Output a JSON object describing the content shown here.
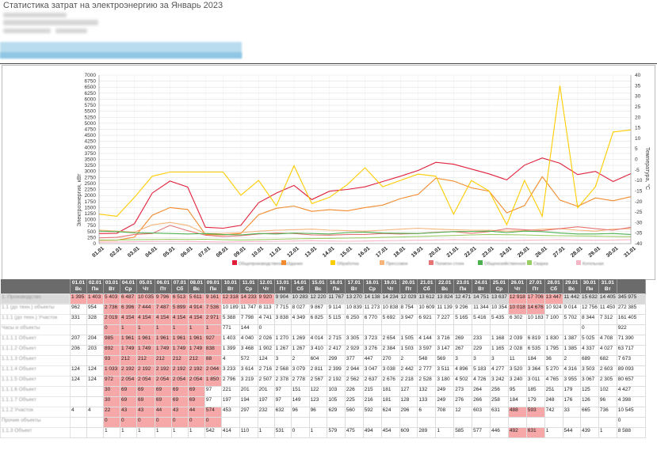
{
  "page": {
    "title": "Статистика затрат на электроэнергию за Январь 2023"
  },
  "chart_data": {
    "type": "line",
    "ylabel": "Электроэнергия, кВт",
    "y2label": "Температура, °С",
    "ylim": [
      0,
      7000
    ],
    "y2lim": [
      -40,
      40
    ],
    "yticks": [
      0,
      250,
      500,
      750,
      1000,
      1250,
      1500,
      1750,
      2000,
      2250,
      2500,
      2750,
      3000,
      3250,
      3500,
      3750,
      4000,
      4250,
      4500,
      4750,
      5000,
      5250,
      5500,
      5750,
      6000,
      6250,
      6500,
      6750,
      7000
    ],
    "y2ticks": [
      40,
      35,
      30,
      25,
      20,
      15,
      10,
      5,
      0,
      -5,
      -10,
      -15,
      -20,
      -25,
      -30,
      -35,
      -40
    ],
    "grid": true,
    "categories": [
      "01.01",
      "02.01",
      "03.01",
      "04.01",
      "05.01",
      "06.01",
      "07.01",
      "08.01",
      "09.01",
      "10.01",
      "11.01",
      "12.01",
      "13.01",
      "14.01",
      "15.01",
      "16.01",
      "17.01",
      "18.01",
      "19.01",
      "20.01",
      "21.01",
      "22.01",
      "23.01",
      "24.01",
      "25.01",
      "26.01",
      "27.01",
      "28.01",
      "29.01",
      "30.01",
      "31.01"
    ],
    "series": [
      {
        "color": "#e0203a",
        "axis": "left",
        "values": [
          420,
          430,
          830,
          2100,
          2600,
          2350,
          680,
          640,
          760,
          1700,
          2100,
          2420,
          1830,
          2180,
          2250,
          2360,
          2580,
          2800,
          3040,
          3380,
          3300,
          3100,
          2900,
          2650,
          3260,
          3560,
          3340,
          2870,
          3000,
          2580,
          2910
        ]
      },
      {
        "color": "#f28b2d",
        "axis": "left",
        "values": [
          130,
          140,
          270,
          1180,
          1500,
          1420,
          380,
          360,
          420,
          1200,
          1470,
          1560,
          1340,
          1410,
          1360,
          1500,
          1600,
          1870,
          2050,
          2720,
          2600,
          2320,
          2180,
          1280,
          1580,
          2780,
          1810,
          1550,
          1900,
          1780,
          1950
        ]
      },
      {
        "color": "#ffcc00",
        "axis": "right",
        "values": [
          -26,
          -27,
          -18,
          -8,
          -6,
          -6,
          -6,
          -6,
          -17,
          -10,
          -22,
          -3,
          -21,
          -18,
          -12,
          -4,
          -13,
          -10,
          -7,
          -8,
          -26,
          -10,
          -15,
          -31,
          -10,
          -27,
          35,
          -23,
          -13,
          13,
          14
        ]
      },
      {
        "color": "#f6b37a",
        "axis": "left",
        "values": [
          560,
          520,
          480,
          780,
          880,
          760,
          420,
          430,
          460,
          520,
          560,
          580,
          600,
          560,
          540,
          520,
          560,
          600,
          640,
          600,
          580,
          560,
          560,
          520,
          540,
          600,
          620,
          560,
          520,
          600,
          620
        ]
      },
      {
        "color": "#e57373",
        "axis": "left",
        "values": [
          240,
          260,
          380,
          420,
          760,
          540,
          350,
          300,
          330,
          400,
          440,
          420,
          360,
          350,
          380,
          380,
          420,
          400,
          420,
          470,
          500,
          430,
          500,
          620,
          580,
          540,
          620,
          700,
          620,
          560,
          680
        ]
      },
      {
        "color": "#4caf50",
        "axis": "left",
        "values": [
          520,
          500,
          450,
          440,
          420,
          400,
          420,
          380,
          360,
          420,
          400,
          440,
          420,
          400,
          460,
          480,
          440,
          430,
          420,
          460,
          500,
          510,
          520,
          460,
          520,
          500,
          440,
          400,
          400,
          420,
          380
        ]
      },
      {
        "color": "#9ccc65",
        "axis": "left",
        "values": [
          150,
          150,
          160,
          170,
          180,
          170,
          180,
          160,
          150,
          160,
          180,
          200,
          210,
          220,
          230,
          240,
          260,
          280,
          300,
          320,
          340,
          360,
          380,
          370,
          360,
          340,
          330,
          320,
          310,
          300,
          290
        ]
      },
      {
        "color": "#f5b6c6",
        "axis": "left",
        "values": [
          60,
          70,
          80,
          90,
          100,
          90,
          80,
          70,
          80,
          90,
          100,
          110,
          120,
          110,
          100,
          110,
          120,
          130,
          140,
          150,
          160,
          150,
          140,
          130,
          140,
          150,
          160,
          150,
          140,
          150,
          160
        ]
      }
    ]
  },
  "legend": [
    "Общепроизводственная",
    "Здания",
    "Обработка",
    "Прессовое",
    "Полигон стоек",
    "Общехозяйственное",
    "Сварка",
    "Котельная"
  ],
  "table": {
    "dates": [
      "01.01",
      "02.01",
      "03.01",
      "04.01",
      "05.01",
      "06.01",
      "07.01",
      "08.01",
      "09.01",
      "10.01",
      "11.01",
      "12.01",
      "13.01",
      "14.01",
      "15.01",
      "16.01",
      "17.01",
      "18.01",
      "19.01",
      "20.01",
      "21.01",
      "22.01",
      "23.01",
      "24.01",
      "25.01",
      "26.01",
      "27.01",
      "28.01",
      "29.01",
      "30.01",
      "31.01"
    ],
    "days": [
      "Вс",
      "Пн",
      "Вт",
      "Ср",
      "Чт",
      "Пт",
      "Сб",
      "Вс",
      "Пн",
      "Вт",
      "Ср",
      "Чт",
      "Пт",
      "Сб",
      "Вс",
      "Пн",
      "Вт",
      "Ср",
      "Чт",
      "Пт",
      "Сб",
      "Вс",
      "Пн",
      "Вт",
      "Ср",
      "Чт",
      "Пт",
      "Сб",
      "Вс",
      "Пн",
      "Вт"
    ],
    "rows": [
      {
        "label": "1. Производство",
        "sum": true,
        "cells": [
          "1 395",
          "1 403",
          "5 403",
          "6 487",
          "10 035",
          "9 796",
          "6 513",
          "5 611",
          "9 161",
          "12 318",
          "14 233",
          "9 920",
          "9 904",
          "10 283",
          "12 220",
          "11 767",
          "13 270",
          "14 138",
          "14 234",
          "12 029",
          "13 612",
          "13 824",
          "12 471",
          "14 751",
          "13 637",
          "12 918",
          "17 706",
          "13 447",
          "11 442",
          "15 632",
          "14 405"
        ],
        "total": "345 975",
        "hl": [
          0,
          1,
          2,
          3,
          4,
          5,
          6,
          7,
          8,
          9,
          10,
          11,
          25,
          26,
          27
        ]
      },
      {
        "label": "1.1 (до техн.) объекты",
        "sum": false,
        "cells": [
          "962",
          "954",
          "2 736",
          "6 396",
          "7 444",
          "7 487",
          "5 899",
          "4 914",
          "7 536",
          "10 189",
          "11 747",
          "8 113",
          "7 715",
          "8 027",
          "9 867",
          "9 114",
          "10 839",
          "11 273",
          "10 838",
          "8 754",
          "10 609",
          "11 139",
          "9 296",
          "11 344",
          "10 354",
          "10 018",
          "14 676",
          "10 924",
          "9 014",
          "12 756",
          "11 450"
        ],
        "total": "272 385",
        "hl": [
          2,
          3,
          4,
          5,
          6,
          7,
          8,
          25,
          26
        ]
      },
      {
        "label": "1.1.1 (до техн.) Участок",
        "sum": false,
        "cells": [
          "331",
          "328",
          "2 019",
          "4 154",
          "4 154",
          "4 154",
          "4 154",
          "4 154",
          "2 971",
          "5 388",
          "7 798",
          "4 741",
          "3 838",
          "4 349",
          "6 825",
          "5 115",
          "6 250",
          "6 770",
          "5 692",
          "3 947",
          "6 921",
          "7 227",
          "5 165",
          "5 416",
          "5 435",
          "6 302",
          "10 183",
          "7 100",
          "5 702",
          "8 344",
          "7 312"
        ],
        "total": "161 405",
        "hl": [
          2,
          3,
          4,
          5,
          6,
          7,
          8
        ]
      },
      {
        "label": "Часы и объекты",
        "sum": false,
        "cells": [
          "",
          "",
          "0",
          "1",
          "1",
          "1",
          "1",
          "1",
          "1",
          "771",
          "144",
          "0",
          "",
          "",
          "",
          "",
          "",
          "",
          "",
          "",
          "",
          "",
          "",
          "",
          "",
          "",
          "",
          "",
          "",
          "0",
          ""
        ],
        "total": "922",
        "hl": [
          2,
          3,
          4,
          5,
          6,
          7,
          8
        ]
      },
      {
        "label": "1.1.1.1 Объект",
        "sum": false,
        "cells": [
          "207",
          "204",
          "985",
          "1 961",
          "1 961",
          "1 961",
          "1 961",
          "1 961",
          "927",
          "1 403",
          "4 040",
          "2 026",
          "1 270",
          "1 269",
          "4 014",
          "2 715",
          "3 305",
          "3 723",
          "2 654",
          "1 505",
          "4 144",
          "3 716",
          "269",
          "233",
          "1 168",
          "2 039",
          "6 819",
          "1 830",
          "1 387",
          "5 025",
          "4 708"
        ],
        "total": "71 390",
        "hl": [
          2,
          3,
          4,
          5,
          6,
          7,
          8
        ]
      },
      {
        "label": "1.1.1.2 Объект",
        "sum": false,
        "cells": [
          "206",
          "203",
          "892",
          "1 749",
          "1 749",
          "1 749",
          "1 749",
          "1 749",
          "838",
          "1 399",
          "3 468",
          "1 902",
          "1 267",
          "1 267",
          "3 410",
          "2 417",
          "2 929",
          "3 276",
          "2 384",
          "1 503",
          "3 597",
          "3 147",
          "267",
          "229",
          "1 165",
          "2 028",
          "6 535",
          "1 795",
          "1 385",
          "4 337",
          "4 027"
        ],
        "total": "63 717",
        "hl": [
          2,
          3,
          4,
          5,
          6,
          7,
          8
        ]
      },
      {
        "label": "1.1.1.3 Объект",
        "sum": false,
        "cells": [
          "",
          "",
          "93",
          "212",
          "212",
          "212",
          "212",
          "212",
          "88",
          "4",
          "572",
          "124",
          "3",
          "2",
          "604",
          "299",
          "377",
          "447",
          "270",
          "2",
          "548",
          "569",
          "3",
          "3",
          "3",
          "11",
          "184",
          "36",
          "2",
          "689",
          "682"
        ],
        "total": "7 673",
        "hl": [
          2,
          3,
          4,
          5,
          6,
          7,
          8
        ]
      },
      {
        "label": "1.1.1.4 Объект",
        "sum": false,
        "cells": [
          "124",
          "124",
          "1 033",
          "2 192",
          "2 192",
          "2 192",
          "2 192",
          "2 192",
          "2 044",
          "3 233",
          "3 614",
          "2 716",
          "2 568",
          "3 079",
          "2 811",
          "2 399",
          "2 944",
          "3 047",
          "3 038",
          "2 442",
          "2 777",
          "3 511",
          "4 896",
          "5 183",
          "4 277",
          "3 520",
          "3 364",
          "5 270",
          "4 316",
          "3 503",
          "2 603"
        ],
        "total": "89 093",
        "hl": [
          2,
          3,
          4,
          5,
          6,
          7,
          8
        ]
      },
      {
        "label": "1.1.1.5 Объект",
        "sum": false,
        "cells": [
          "124",
          "124",
          "972",
          "2 054",
          "2 054",
          "2 054",
          "2 054",
          "2 054",
          "1 850",
          "2 796",
          "3 219",
          "2 507",
          "2 378",
          "2 778",
          "2 567",
          "2 192",
          "2 562",
          "2 637",
          "2 676",
          "2 218",
          "2 528",
          "3 180",
          "4 502",
          "4 726",
          "3 242",
          "3 240",
          "3 011",
          "4 765",
          "3 955",
          "3 067",
          "2 305"
        ],
        "total": "80 657",
        "hl": [
          2,
          3,
          4,
          5,
          6,
          7,
          8
        ]
      },
      {
        "label": "1.1.1.6 Объект",
        "sum": false,
        "cells": [
          "",
          "",
          "30",
          "69",
          "69",
          "69",
          "69",
          "69",
          "97",
          "221",
          "201",
          "201",
          "97",
          "151",
          "122",
          "103",
          "226",
          "215",
          "181",
          "127",
          "132",
          "249",
          "273",
          "264",
          "256",
          "95",
          "185",
          "251",
          "179",
          "125",
          "102"
        ],
        "total": "4 427",
        "hl": [
          2,
          3,
          4,
          5,
          6,
          7
        ]
      },
      {
        "label": "1.1.1.7 Объект",
        "sum": false,
        "cells": [
          "",
          "",
          "30",
          "69",
          "69",
          "69",
          "69",
          "69",
          "97",
          "197",
          "194",
          "197",
          "97",
          "149",
          "123",
          "105",
          "225",
          "216",
          "181",
          "128",
          "133",
          "249",
          "276",
          "266",
          "258",
          "184",
          "179",
          "248",
          "176",
          "126",
          "96"
        ],
        "total": "4 398",
        "hl": [
          2,
          3,
          4,
          5,
          6,
          7
        ]
      },
      {
        "label": "1.1.2 Участок",
        "sum": false,
        "cells": [
          "4",
          "4",
          "22",
          "43",
          "43",
          "44",
          "43",
          "44",
          "574",
          "453",
          "297",
          "232",
          "632",
          "96",
          "96",
          "629",
          "560",
          "592",
          "624",
          "296",
          "6",
          "708",
          "12",
          "603",
          "631",
          "488",
          "593",
          "742",
          "33",
          "665",
          "736"
        ],
        "total": "10 545",
        "hl": [
          2,
          3,
          4,
          5,
          6,
          7,
          8,
          25,
          26
        ]
      },
      {
        "label": "Прочие объекты",
        "sum": false,
        "cells": [
          "",
          "",
          "0",
          "0",
          "0",
          "0",
          "0",
          "0",
          "0",
          "",
          "",
          "",
          "",
          "",
          "",
          "",
          "",
          "",
          "",
          "",
          "",
          "",
          "",
          "",
          "",
          "",
          "",
          "",
          "",
          "",
          ""
        ],
        "total": "0",
        "hl": [
          2,
          3,
          4,
          5,
          6,
          7,
          8
        ]
      },
      {
        "label": "1.1.3 Объект",
        "sum": false,
        "cells": [
          "",
          "",
          "1",
          "1",
          "1",
          "1",
          "1",
          "1",
          "542",
          "414",
          "110",
          "1",
          "531",
          "0",
          "1",
          "579",
          "475",
          "494",
          "454",
          "609",
          "289",
          "1",
          "585",
          "577",
          "446",
          "492",
          "631",
          "1",
          "544",
          "439",
          "1"
        ],
        "total": "8 588",
        "hl": [
          25,
          26
        ]
      }
    ]
  }
}
